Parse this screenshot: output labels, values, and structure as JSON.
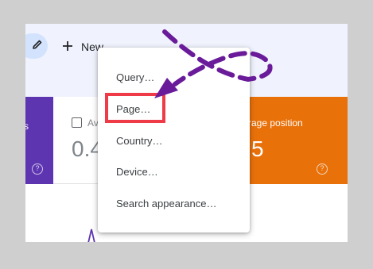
{
  "toolbar": {
    "edit_icon": "pencil-icon",
    "new_icon": "plus-icon",
    "new_label": "New"
  },
  "cards": {
    "left_fragment": "s",
    "middle_fragment_label": "Av",
    "middle_fragment_value": "0.4",
    "right_fragment_label": "rage position",
    "right_fragment_value": "5",
    "help_icon": "help-circle-icon"
  },
  "menu": {
    "items": [
      "Query…",
      "Page…",
      "Country…",
      "Device…",
      "Search appearance…"
    ]
  },
  "annotation": {
    "highlight_color": "#ef3b47",
    "arrow_color": "#6a1b9a"
  },
  "colors": {
    "purple_card": "#5e35b1",
    "orange_card": "#e8710a",
    "topbar": "#f0f3fd"
  }
}
